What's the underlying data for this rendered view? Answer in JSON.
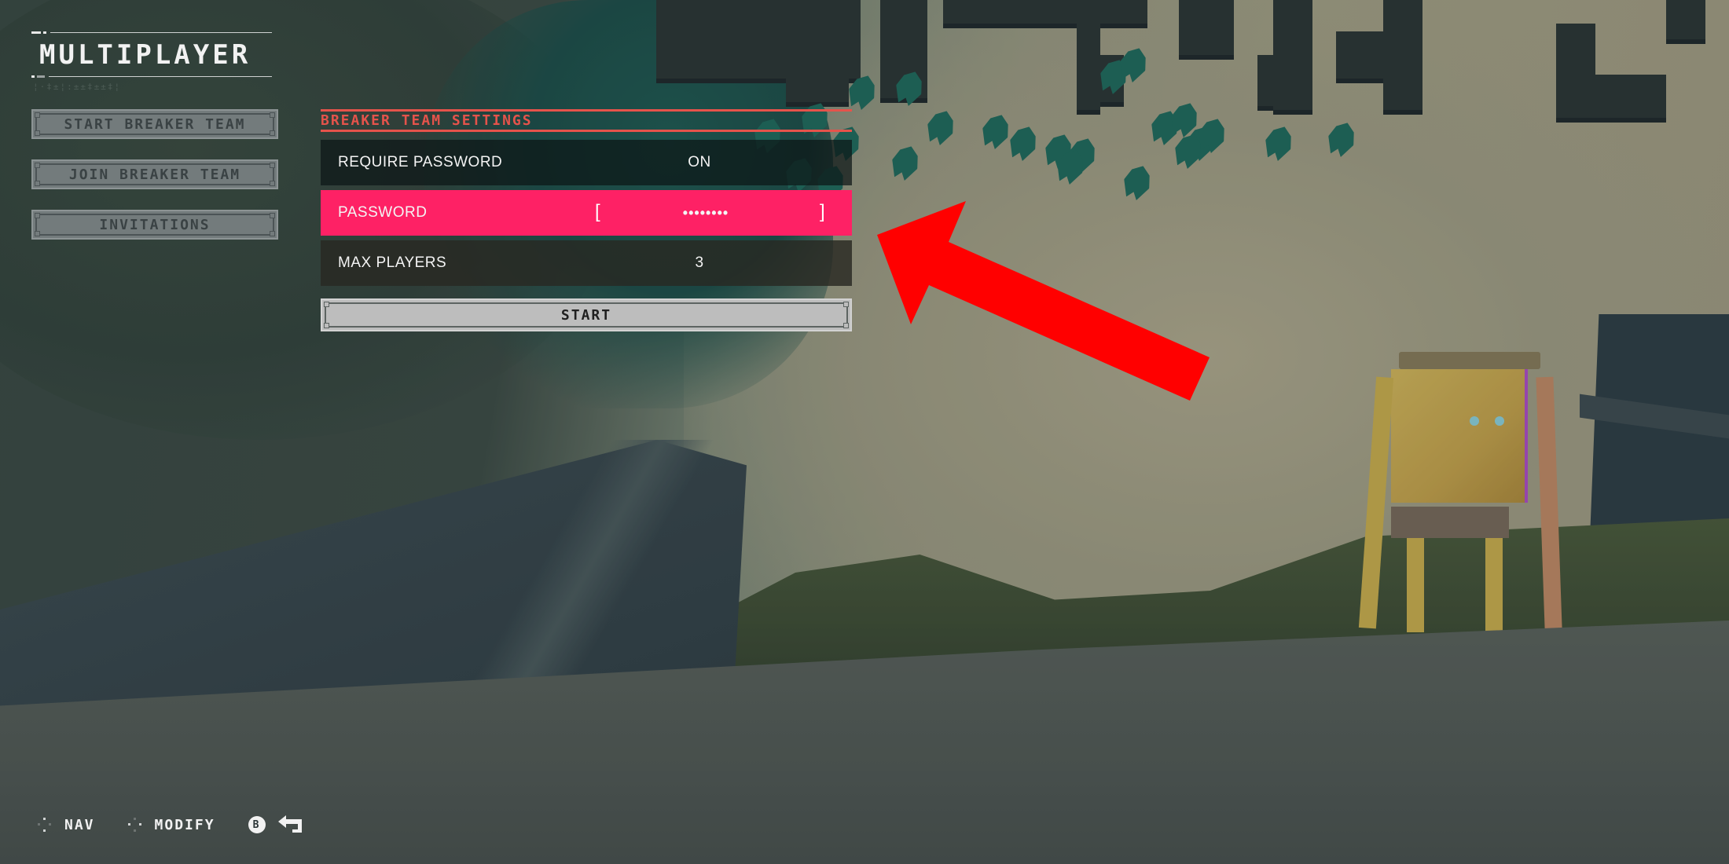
{
  "header": {
    "title": "MULTIPLAYER",
    "subtitle_glyphs": "¦·‡±¦:±±‡±±‡¦"
  },
  "side_menu": {
    "items": [
      {
        "label": "START BREAKER TEAM"
      },
      {
        "label": "JOIN BREAKER TEAM"
      },
      {
        "label": "INVITATIONS"
      }
    ]
  },
  "settings": {
    "title": "BREAKER TEAM SETTINGS",
    "rows": [
      {
        "label": "REQUIRE PASSWORD",
        "value": "ON",
        "state": "normal"
      },
      {
        "label": "PASSWORD",
        "value": "••••••••",
        "bracket_left": "[",
        "bracket_right": "]",
        "state": "selected"
      },
      {
        "label": "MAX PLAYERS",
        "value": "3",
        "state": "normal"
      }
    ],
    "start_label": "START"
  },
  "hints": {
    "nav_label": "NAV",
    "modify_label": "MODIFY",
    "back_button_glyph": "B",
    "icons": [
      "dpad-vertical-icon",
      "dpad-horizontal-icon",
      "b-button-icon",
      "back-arrow-icon"
    ]
  },
  "colors": {
    "accent_red": "#e5534b",
    "selected_row": "#fe2165",
    "annotation_arrow": "#ff0000",
    "start_button": "#bdbdbd",
    "side_button": "#737b7c"
  },
  "annotation": {
    "type": "arrow",
    "points_to": "password-row"
  }
}
